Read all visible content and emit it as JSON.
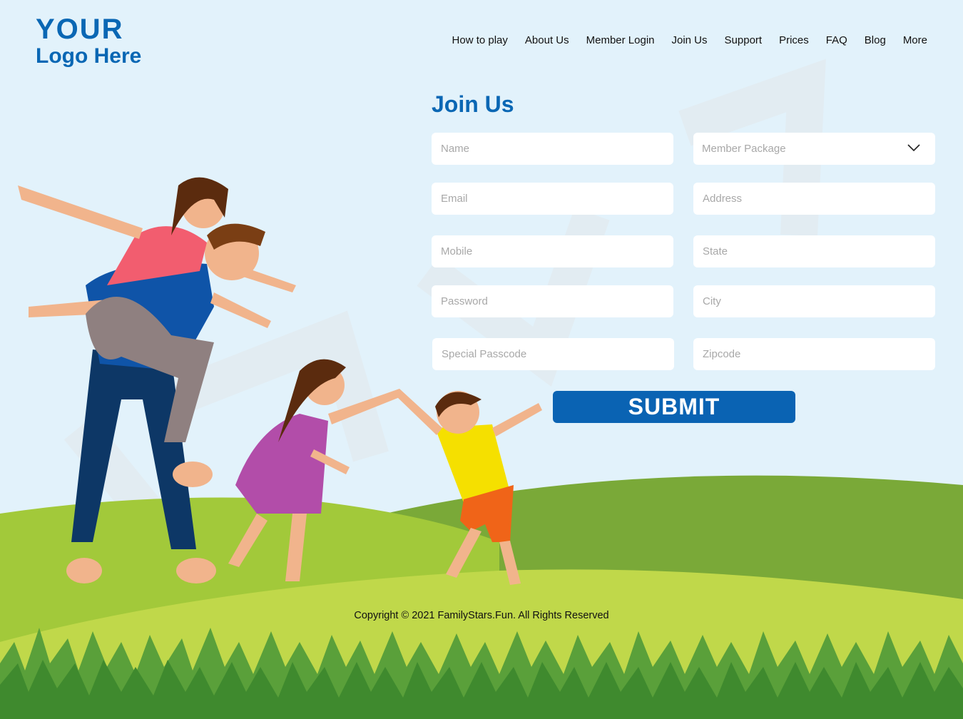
{
  "logo": {
    "line1": "YOUR",
    "line2": "Logo Here"
  },
  "nav": [
    "How to play",
    "About Us",
    "Member Login",
    "Join Us",
    "Support",
    "Prices",
    "FAQ",
    "Blog",
    "More"
  ],
  "form": {
    "title": "Join Us",
    "placeholders": {
      "name": "Name",
      "member_package": "Member Package",
      "email": "Email",
      "address": "Address",
      "mobile": "Mobile",
      "state": "State",
      "password": "Password",
      "city": "City",
      "special_passcode": "Special Passcode",
      "zipcode": "Zipcode"
    },
    "submit_label": "SUBMIT"
  },
  "footer": {
    "copyright": "Copyright © 2021 FamilyStars.Fun. All Rights Reserved"
  },
  "colors": {
    "brand": "#0a67b4",
    "sky": "#e2f2fb",
    "hill_light": "#c0d84a",
    "hill_dark": "#7aa938",
    "grass": "#3f8a2e"
  }
}
